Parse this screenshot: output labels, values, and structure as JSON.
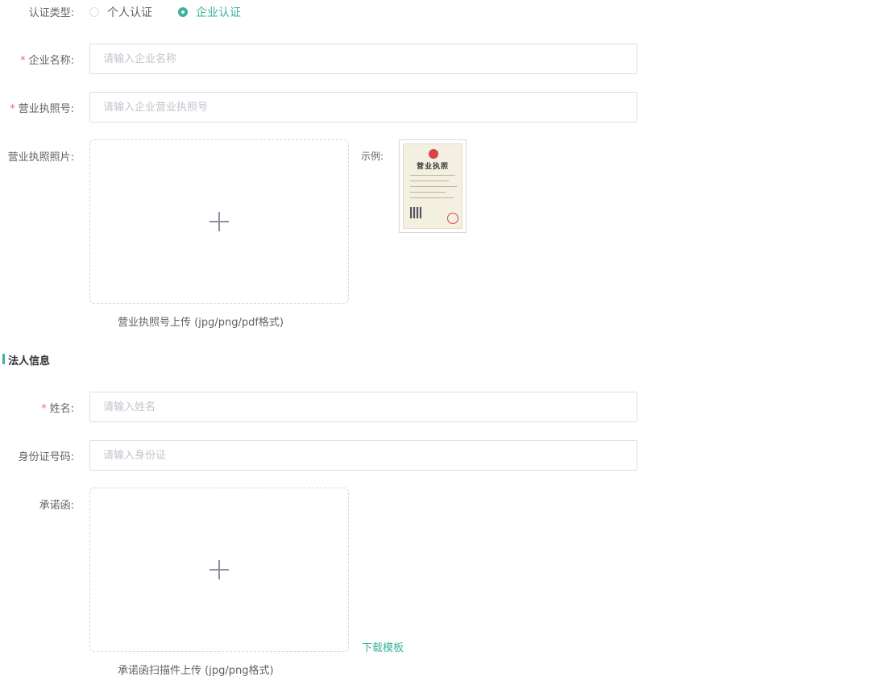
{
  "cert_type": {
    "label": "认证类型:",
    "options": [
      {
        "label": "个人认证",
        "checked": false
      },
      {
        "label": "企业认证",
        "checked": true
      }
    ]
  },
  "company": {
    "name": {
      "required_mark": "*",
      "label": "企业名称:",
      "placeholder": "请输入企业名称",
      "value": ""
    },
    "license_no": {
      "required_mark": "*",
      "label": "营业执照号:",
      "placeholder": "请输入企业营业执照号",
      "value": ""
    },
    "license_photo": {
      "label": "营业执照照片:",
      "upload_hint": "营业执照号上传 (jpg/png/pdf格式)",
      "example_label": "示例:",
      "example_title": "营业执照",
      "upload_icon": "plus-icon"
    }
  },
  "legal": {
    "section_title": "法人信息",
    "name": {
      "required_mark": "*",
      "label": "姓名:",
      "placeholder": "请输入姓名",
      "value": ""
    },
    "id_no": {
      "label": "身份证号码:",
      "placeholder": "请输入身份证",
      "value": ""
    },
    "letter": {
      "label": "承诺函:",
      "upload_hint": "承诺函扫描件上传 (jpg/png格式)",
      "download_link": "下载模板",
      "upload_icon": "plus-icon"
    }
  },
  "colors": {
    "accent": "#3bb39a",
    "required": "#f56c6c",
    "border": "#dcdfe6",
    "placeholder": "#c0c4cc"
  }
}
